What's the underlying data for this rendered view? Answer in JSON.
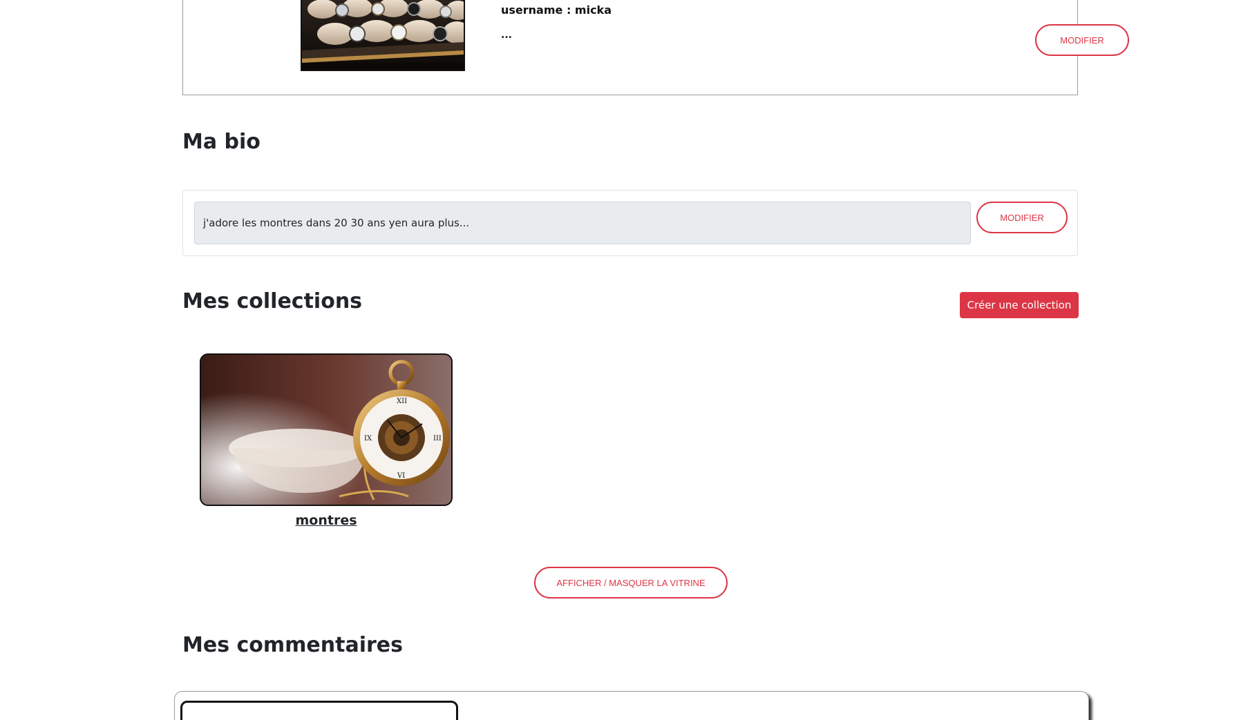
{
  "profile": {
    "username_text": "username : micka",
    "extra_text": "...",
    "edit_label": "MODIFIER"
  },
  "bio": {
    "title": "Ma bio",
    "text": "j'adore les montres dans 20 30 ans yen aura plus...",
    "edit_label": "MODIFIER"
  },
  "collections": {
    "title": "Mes collections",
    "create_label": "Créer une collection",
    "items": [
      {
        "name": "montres"
      }
    ],
    "toggle_label": "AFFICHER / MASQUER LA VITRINE"
  },
  "comments": {
    "title": "Mes commentaires"
  },
  "colors": {
    "accent": "#dc3545",
    "input_bg": "#e9ecef",
    "text": "#212529"
  }
}
